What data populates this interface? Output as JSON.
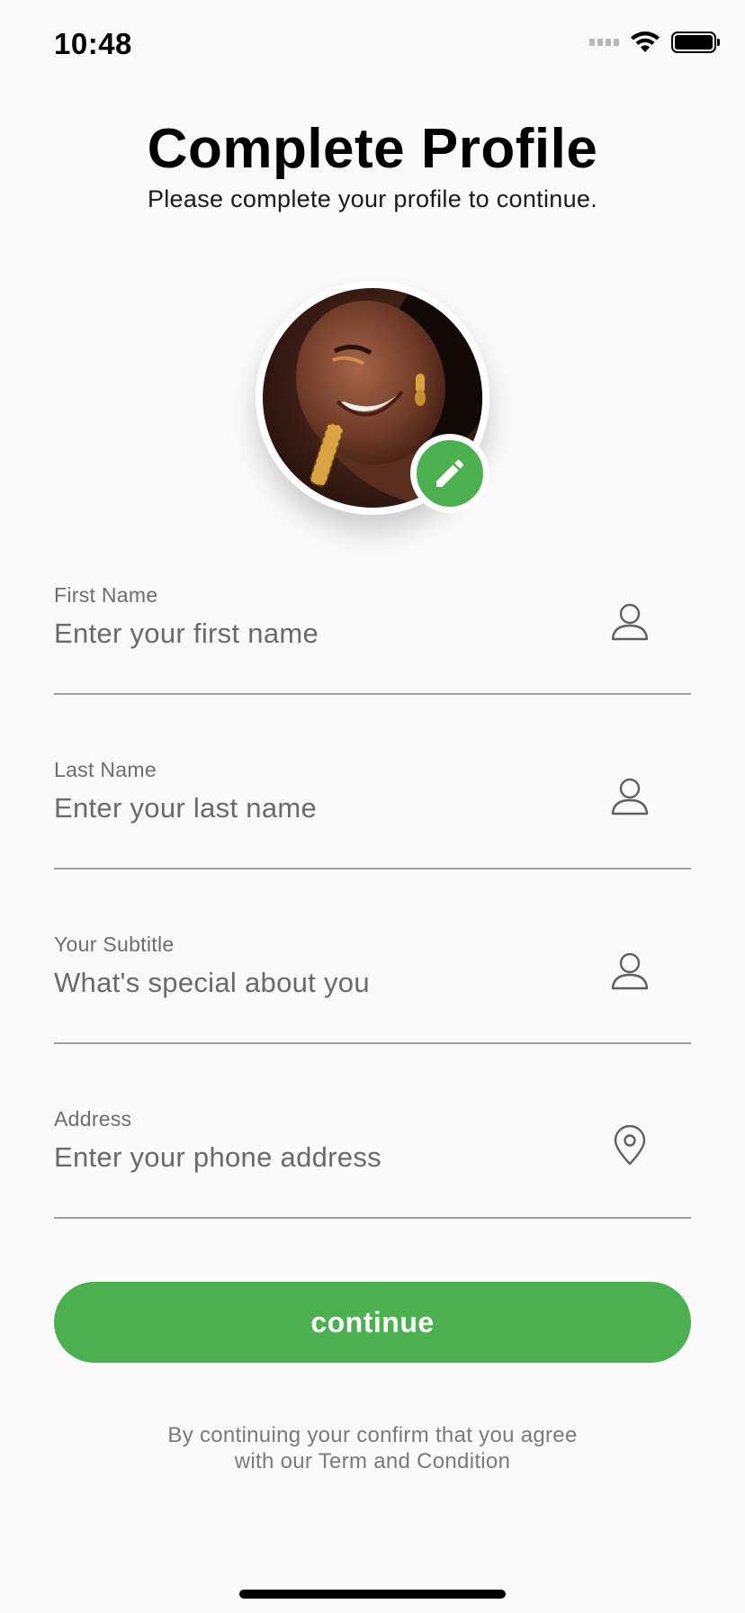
{
  "status_bar": {
    "time": "10:48",
    "icons": [
      "signal-icon",
      "wifi-icon",
      "battery-icon"
    ]
  },
  "header": {
    "title": "Complete Profile",
    "subtitle": "Please complete your profile to continue."
  },
  "avatar": {
    "edit_icon": "pencil-icon",
    "accent_color": "#4caf50"
  },
  "form": {
    "fields": [
      {
        "label": "First Name",
        "placeholder": "Enter your first name",
        "value": "",
        "icon": "user-icon"
      },
      {
        "label": "Last Name",
        "placeholder": "Enter your last name",
        "value": "",
        "icon": "user-icon"
      },
      {
        "label": "Your Subtitle",
        "placeholder": "What's special about you",
        "value": "",
        "icon": "user-icon"
      },
      {
        "label": "Address",
        "placeholder": "Enter your phone address",
        "value": "",
        "icon": "location-pin-icon"
      }
    ]
  },
  "actions": {
    "continue_label": "continue",
    "button_color": "#4caf50"
  },
  "footer": {
    "terms_line1": "By continuing your confirm that you agree",
    "terms_line2": "with our Term and Condition"
  }
}
